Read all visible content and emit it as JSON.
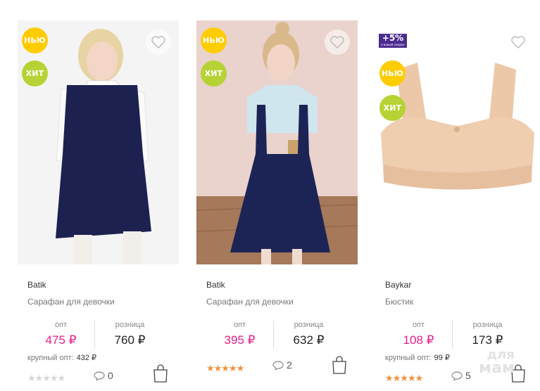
{
  "products": [
    {
      "badges": [
        "НЬЮ",
        "ХИТ"
      ],
      "brand": "Batik",
      "title": "Сарафан для девочки",
      "opt_caption": "опт",
      "opt_price": "475 ₽",
      "retail_caption": "розница",
      "retail_price": "760 ₽",
      "bulk_label": "крупный опт:",
      "bulk_price": "432 ₽",
      "rating": "★★★★★",
      "rating_active": false,
      "comments": "0",
      "image_icon": "girl-dark-blue-sarafan-photo"
    },
    {
      "badges": [
        "НЬЮ",
        "ХИТ"
      ],
      "brand": "Batik",
      "title": "Сарафан для девочки",
      "opt_caption": "опт",
      "opt_price": "395 ₽",
      "retail_caption": "розница",
      "retail_price": "632 ₽",
      "rating": "★★★★★",
      "rating_active": true,
      "comments": "2",
      "image_icon": "girl-navy-sarafan-photo"
    },
    {
      "discount": "+5%",
      "discount_sub": "к вашей скидке",
      "badges": [
        "НЬЮ",
        "ХИТ"
      ],
      "brand": "Baykar",
      "title": "Бюстик",
      "opt_caption": "опт",
      "opt_price": "108 ₽",
      "retail_caption": "розница",
      "retail_price": "173 ₽",
      "bulk_label": "крупный опт:",
      "bulk_price": "99 ₽",
      "rating": "★★★★★",
      "rating_active": true,
      "comments": "5",
      "image_icon": "beige-top-photo"
    }
  ],
  "watermark": {
    "line1": "для",
    "line2": "мам"
  },
  "colors": {
    "opt_price": "#e91e8c",
    "badge_new": "#ffcc00",
    "badge_hit": "#b5d334",
    "star_on": "#f3913d",
    "discount_bg": "#4b2c8f"
  }
}
